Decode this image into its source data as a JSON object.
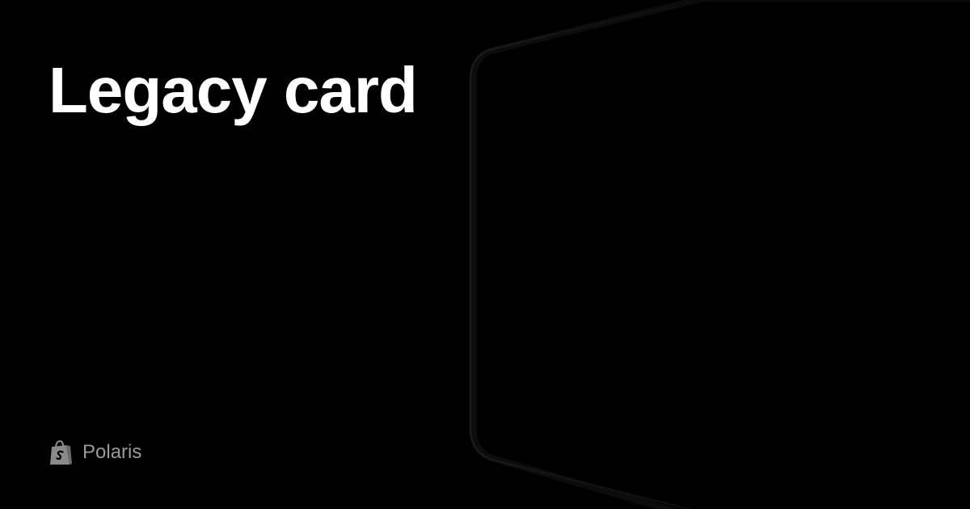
{
  "page": {
    "title": "Legacy card",
    "background_color": "#000000",
    "title_color": "#ffffff"
  },
  "brand": {
    "name": "Polaris",
    "icon": "shopify-bag-icon",
    "color": "#9a9a9a"
  },
  "illustration": {
    "description_icon": "perspective-card-outline",
    "stroke_color": "#141414"
  }
}
